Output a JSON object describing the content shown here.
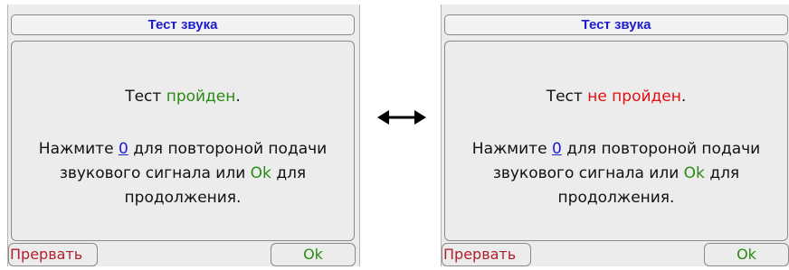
{
  "left_screen": {
    "title": "Тест звука",
    "result_prefix": "Тест",
    "result_status": "пройден",
    "result_suffix": ".",
    "instr_prefix": "Нажмите",
    "instr_key": "0",
    "instr_middle": "для повтороной подачи звукового сигнала или",
    "instr_ok": "Ok",
    "instr_suffix": "для продолжения.",
    "abort_label": "Прервать",
    "ok_label": "Ok"
  },
  "right_screen": {
    "title": "Тест звука",
    "result_prefix": "Тест",
    "result_status": "не пройден",
    "result_suffix": ".",
    "instr_prefix": "Нажмите",
    "instr_key": "0",
    "instr_middle": "для повтороной подачи звукового сигнала или",
    "instr_ok": "Ok",
    "instr_suffix": "для продолжения.",
    "abort_label": "Прервать",
    "ok_label": "Ok"
  },
  "arrow_icon": "double-headed-arrow-icon",
  "colors": {
    "title": "#1c1ccc",
    "passed": "#2a8a14",
    "failed": "#e01010",
    "abort": "#b0212e",
    "background": "#ececec"
  }
}
